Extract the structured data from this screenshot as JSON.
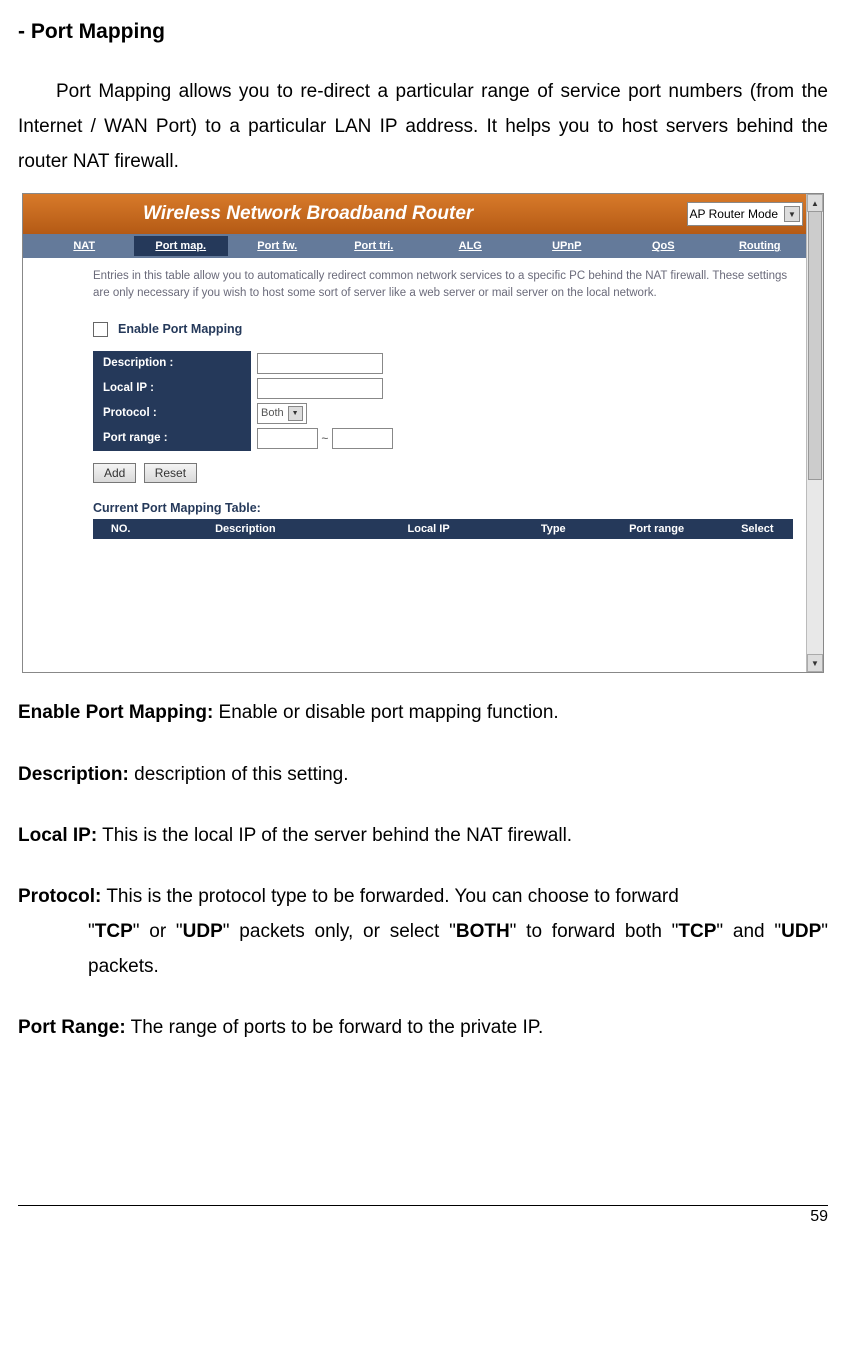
{
  "heading": "- Port Mapping",
  "intro": "Port Mapping allows you to re-direct a particular range of service port numbers (from the Internet / WAN Port) to a particular LAN IP address. It helps you to host servers behind the router NAT firewall.",
  "router": {
    "banner_title": "Wireless Network Broadband Router",
    "mode": "AP Router Mode",
    "tabs": [
      "NAT",
      "Port map.",
      "Port fw.",
      "Port tri.",
      "ALG",
      "UPnP",
      "QoS",
      "Routing"
    ],
    "active_tab_index": 1,
    "helptext": "Entries in this table allow you to automatically redirect common network services to a specific PC behind the NAT firewall. These settings are only necessary if you wish to host some sort of server like a web server or mail server on the local network.",
    "enable_label": "Enable Port Mapping",
    "fields": {
      "description": "Description :",
      "local_ip": "Local IP :",
      "protocol": "Protocol :",
      "port_range": "Port range :"
    },
    "protocol_value": "Both",
    "port_range_sep": "~",
    "buttons": {
      "add": "Add",
      "reset": "Reset"
    },
    "current_title": "Current Port Mapping Table:",
    "columns": [
      "NO.",
      "Description",
      "Local IP",
      "Type",
      "Port range",
      "Select"
    ]
  },
  "defs": {
    "enable": {
      "term": "Enable Port Mapping:",
      "text": " Enable or disable port mapping function."
    },
    "description": {
      "term": "Description:",
      "text": " description of this setting."
    },
    "localip": {
      "term": "Local IP:",
      "text": " This is the local IP of the server behind the NAT firewall."
    },
    "protocol": {
      "term": "Protocol:",
      "t1": " This is the protocol type to be forwarded. You can choose to forward ",
      "q1": "\"",
      "tcp": "TCP",
      "q2": "\" or \"",
      "udp": "UDP",
      "q3": "\" packets only, or select \"",
      "both": "BOTH",
      "q4": "\" to forward both \"",
      "tcp2": "TCP",
      "q5": "\" and \"",
      "udp2": "UDP",
      "q6": "\" packets."
    },
    "portrange": {
      "term": "Port Range:",
      "text": " The range of ports to be forward to the private IP."
    }
  },
  "page_number": "59"
}
